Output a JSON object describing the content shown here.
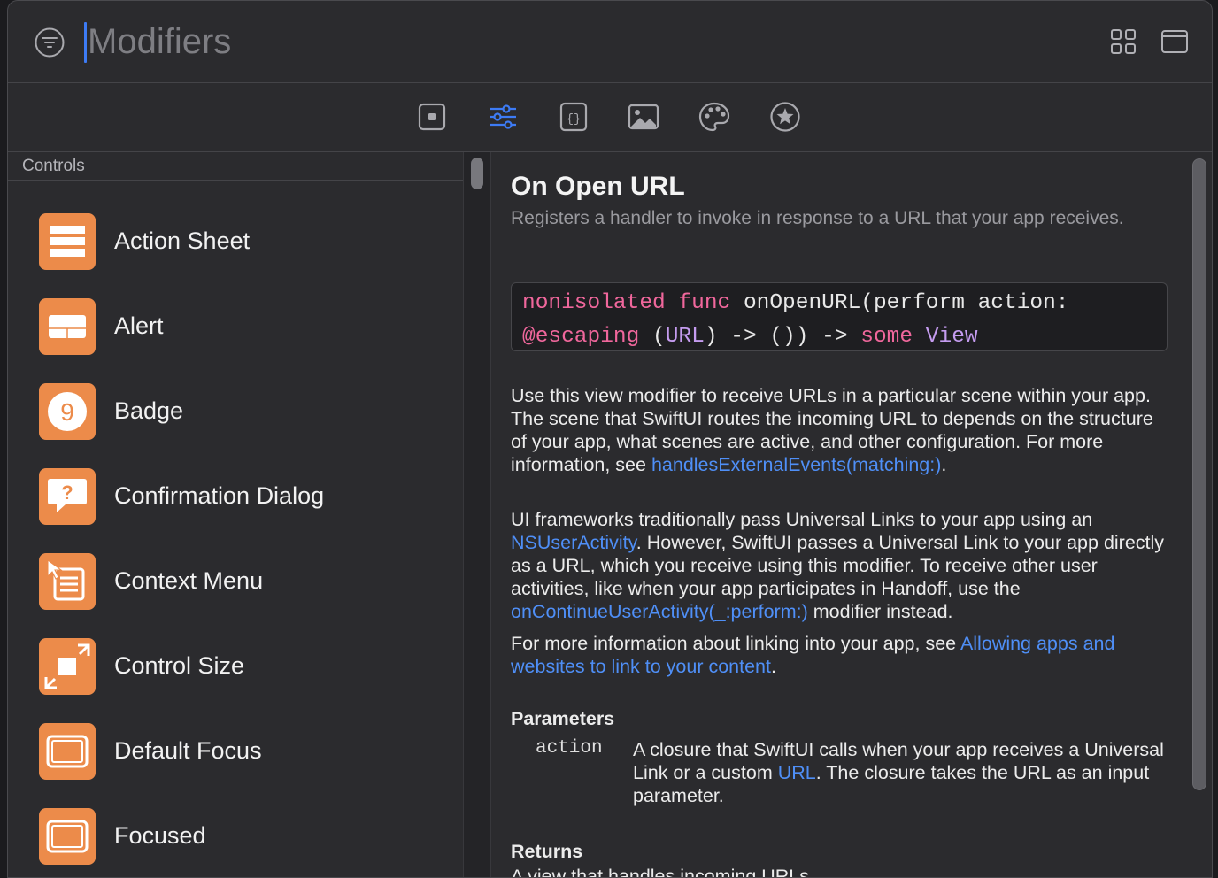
{
  "search": {
    "placeholder": "Modifiers",
    "value": ""
  },
  "header_icons": [
    "filter-icon",
    "grid-view-icon",
    "panel-toggle-icon"
  ],
  "toolbar": {
    "tabs": [
      {
        "icon": "views-icon",
        "selected": false
      },
      {
        "icon": "modifiers-icon",
        "selected": true
      },
      {
        "icon": "code-snippets-icon",
        "selected": false
      },
      {
        "icon": "image-icon",
        "selected": false
      },
      {
        "icon": "color-palette-icon",
        "selected": false
      },
      {
        "icon": "symbols-icon",
        "selected": false
      }
    ]
  },
  "sidebar": {
    "section": "Controls",
    "items": [
      {
        "label": "Action Sheet",
        "icon": "action-sheet-icon"
      },
      {
        "label": "Alert",
        "icon": "alert-icon"
      },
      {
        "label": "Badge",
        "icon": "badge-icon"
      },
      {
        "label": "Confirmation Dialog",
        "icon": "confirmation-dialog-icon"
      },
      {
        "label": "Context Menu",
        "icon": "context-menu-icon"
      },
      {
        "label": "Control Size",
        "icon": "control-size-icon"
      },
      {
        "label": "Default Focus",
        "icon": "default-focus-icon"
      },
      {
        "label": "Focused",
        "icon": "focused-icon"
      }
    ]
  },
  "doc": {
    "title": "On Open URL",
    "subtitle": "Registers a handler to invoke in response to a URL that your app receives.",
    "code": {
      "l1_kw1": "nonisolated",
      "l1_kw2": "func",
      "l1_rest": "onOpenURL(perform action:",
      "l2_attr": "@escaping",
      "l2_p1": "(",
      "l2_type": "URL",
      "l2_p2": ") -> ()) ->",
      "l2_kw": "some",
      "l2_view": "View"
    },
    "p1": {
      "text": "Use this view modifier to receive URLs in a particular scene within your app. The scene that SwiftUI routes the incoming URL to depends on the structure of your app, what scenes are active, and other configuration. For more information, see",
      "link": "handlesExternalEvents(matching:)",
      "end": "."
    },
    "p2": {
      "t1": "UI frameworks traditionally pass Universal Links to your app using an",
      "link1": "NSUserActivity",
      "t2": ". However, SwiftUI passes a Universal Link to your app directly as a URL, which you receive using this modifier. To receive other user activities, like when your app participates in Handoff, use the",
      "link2": "onContinueUserActivity(_:perform:)",
      "t3": "modifier instead."
    },
    "p3": {
      "t1": "For more information about linking into your app, see",
      "link": "Allowing apps and websites to link to your content",
      "end": "."
    },
    "parameters": {
      "heading": "Parameters",
      "name": "action",
      "d1": "A closure that SwiftUI calls when your app receives a Universal Link or a custom",
      "link": "URL",
      "d2": ". The closure takes the URL as an input parameter."
    },
    "returns": {
      "heading": "Returns",
      "text": "A view that handles incoming URLs."
    }
  },
  "colors": {
    "accent": "#3d7bf5",
    "icon_orange": "#ec8b4a",
    "link": "#4f8ff7",
    "keyword": "#f0679c",
    "type": "#c59cf0"
  }
}
